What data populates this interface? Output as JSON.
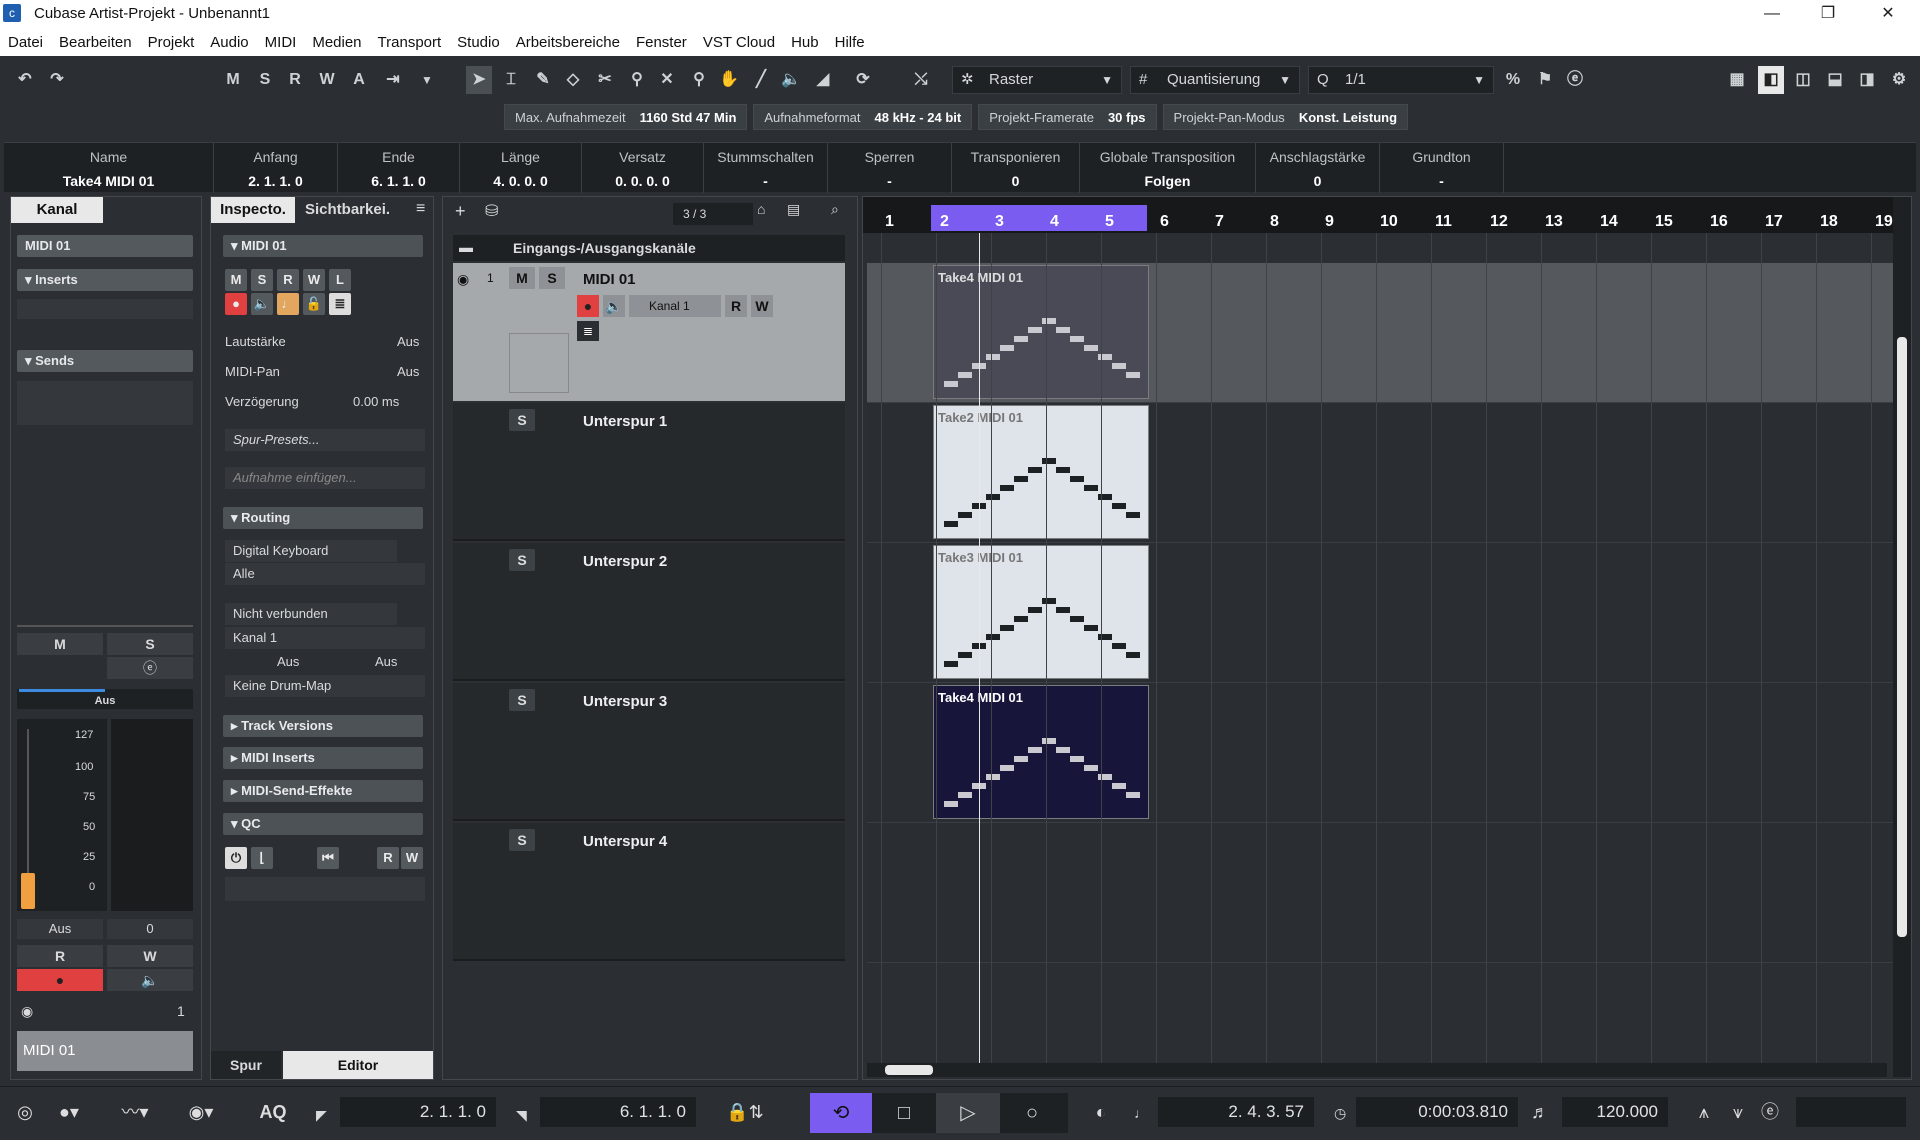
{
  "window": {
    "title": "Cubase Artist-Projekt - Unbenannt1",
    "minimize": "—",
    "maximize": "❐",
    "close": "✕"
  },
  "menu": [
    "Datei",
    "Bearbeiten",
    "Projekt",
    "Audio",
    "MIDI",
    "Medien",
    "Transport",
    "Studio",
    "Arbeitsbereiche",
    "Fenster",
    "VST Cloud",
    "Hub",
    "Hilfe"
  ],
  "toolbar": {
    "m": "M",
    "s": "S",
    "r": "R",
    "w": "W",
    "a": "A",
    "snap": "Raster",
    "quant": "Quantisierung",
    "qvalue": "1/1"
  },
  "status": [
    {
      "label": "Max. Aufnahmezeit",
      "value": "1160 Std 47 Min"
    },
    {
      "label": "Aufnahmeformat",
      "value": "48 kHz - 24 bit"
    },
    {
      "label": "Projekt-Framerate",
      "value": "30 fps"
    },
    {
      "label": "Projekt-Pan-Modus",
      "value": "Konst. Leistung"
    }
  ],
  "info": [
    {
      "h": "Name",
      "v": "Take4 MIDI 01"
    },
    {
      "h": "Anfang",
      "v": "2. 1. 1.   0"
    },
    {
      "h": "Ende",
      "v": "6. 1. 1.   0"
    },
    {
      "h": "Länge",
      "v": "4. 0. 0.   0"
    },
    {
      "h": "Versatz",
      "v": "0. 0. 0.   0"
    },
    {
      "h": "Stummschalten",
      "v": "-"
    },
    {
      "h": "Sperren",
      "v": "-"
    },
    {
      "h": "Transponieren",
      "v": "0"
    },
    {
      "h": "Globale Transposition",
      "v": "Folgen"
    },
    {
      "h": "Anschlagstärke",
      "v": "0"
    },
    {
      "h": "Grundton",
      "v": "-"
    }
  ],
  "kanal": {
    "tab": "Kanal",
    "name": "MIDI 01",
    "inserts": "Inserts",
    "sends": "Sends",
    "m": "M",
    "s": "S",
    "pan": "Aus",
    "scale": [
      "127",
      "100",
      "75",
      "50",
      "25",
      "0"
    ],
    "vol_label": "Aus",
    "vol_value": "0",
    "r": "R",
    "w": "W",
    "chan": "1",
    "footer": "MIDI 01"
  },
  "inspector": {
    "tab1": "Inspecto.",
    "tab2": "Sichtbarkei.",
    "track": "MIDI 01",
    "m": "M",
    "s": "S",
    "r": "R",
    "w": "W",
    "l": "L",
    "lautstaerke": "Lautstärke",
    "aus1": "Aus",
    "midipan": "MIDI-Pan",
    "aus2": "Aus",
    "verz": "Verzögerung",
    "verz_val": "0.00 ms",
    "presets": "Spur-Presets...",
    "aufnahme": "Aufnahme einfügen...",
    "routing": "Routing",
    "input": "Digital Keyboard",
    "alle": "Alle",
    "output": "Nicht verbunden",
    "kanal": "Kanal 1",
    "aus3": "Aus",
    "aus4": "Aus",
    "drum": "Keine Drum-Map",
    "versions": "Track Versions",
    "midiinserts": "MIDI Inserts",
    "sendfx": "MIDI-Send-Effekte",
    "qc": "QC",
    "bottom1": "Spur",
    "bottom2": "Editor"
  },
  "tracklist": {
    "counter": "3 / 3",
    "folder": "Eingangs-/Ausgangskanäle",
    "num": "1",
    "main": "MIDI 01",
    "m": "M",
    "s": "S",
    "kanal": "Kanal 1",
    "r": "R",
    "w": "W",
    "lanes": [
      "Unterspur 1",
      "Unterspur 2",
      "Unterspur 3",
      "Unterspur 4"
    ]
  },
  "ruler": [
    "1",
    "2",
    "3",
    "4",
    "5",
    "6",
    "7",
    "8",
    "9",
    "10",
    "11",
    "12",
    "13",
    "14",
    "15",
    "16",
    "17",
    "18",
    "19"
  ],
  "events": [
    {
      "label": "Take4 MIDI 01"
    },
    {
      "label": "Take2 MIDI 01"
    },
    {
      "label": "Take3 MIDI 01"
    },
    {
      "label": "Take4 MIDI 01"
    }
  ],
  "transport": {
    "left": "2. 1. 1.   0",
    "right": "6. 1. 1.   0",
    "pos": "2. 4. 3.  57",
    "time": "0:00:03.810",
    "tempo": "120.000",
    "aq": "AQ"
  }
}
